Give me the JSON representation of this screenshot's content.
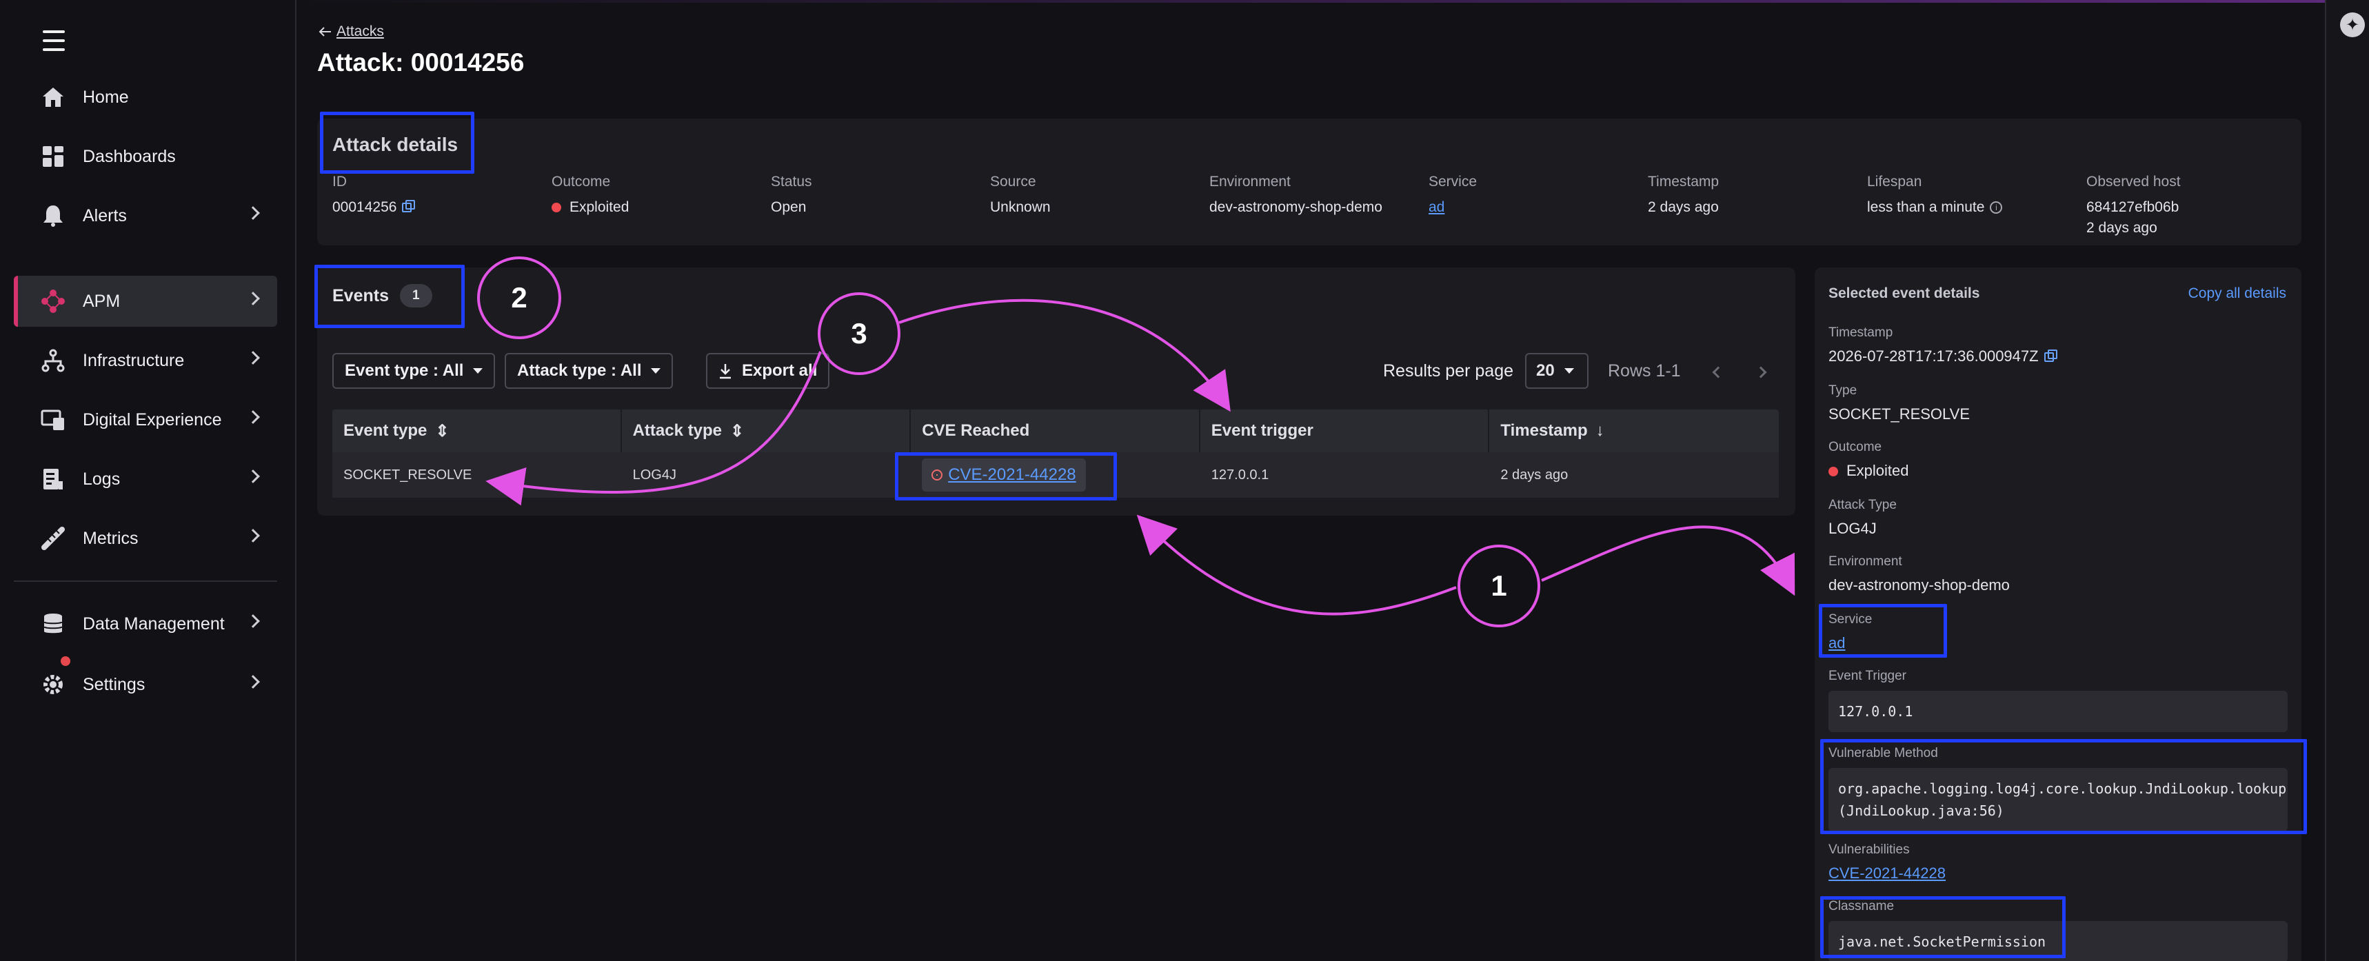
{
  "sidebar": {
    "items": [
      {
        "label": "Home",
        "icon": "home-icon"
      },
      {
        "label": "Dashboards",
        "icon": "dashboards-icon"
      },
      {
        "label": "Alerts",
        "icon": "bell-icon"
      },
      {
        "label": "APM",
        "icon": "apm-icon",
        "active": true
      },
      {
        "label": "Infrastructure",
        "icon": "infrastructure-icon"
      },
      {
        "label": "Digital Experience",
        "icon": "digital-experience-icon"
      },
      {
        "label": "Logs",
        "icon": "logs-icon"
      },
      {
        "label": "Metrics",
        "icon": "metrics-icon"
      },
      {
        "label": "Data Management",
        "icon": "database-icon"
      },
      {
        "label": "Settings",
        "icon": "gear-icon"
      }
    ]
  },
  "header": {
    "back_label": "Attacks",
    "title": "Attack: 00014256"
  },
  "details": {
    "title": "Attack details",
    "fields": [
      {
        "label": "ID",
        "value": "00014256"
      },
      {
        "label": "Outcome",
        "value": "Exploited"
      },
      {
        "label": "Status",
        "value": "Open"
      },
      {
        "label": "Source",
        "value": "Unknown"
      },
      {
        "label": "Environment",
        "value": "dev-astronomy-shop-demo"
      },
      {
        "label": "Service",
        "value": "ad"
      },
      {
        "label": "Timestamp",
        "value": "2 days ago"
      },
      {
        "label": "Lifespan",
        "value": "less than a minute"
      },
      {
        "label": "Observed host",
        "value": "684127efb06b",
        "value2": "2 days ago"
      }
    ]
  },
  "events": {
    "tab_label": "Events",
    "count": "1",
    "filters": {
      "event_type": "Event type : All",
      "attack_type": "Attack type : All",
      "export": "Export all"
    },
    "results_per_page_label": "Results per page",
    "results_per_page": "20",
    "rows_label": "Rows 1-1",
    "columns": [
      "Event type",
      "Attack type",
      "CVE Reached",
      "Event trigger",
      "Timestamp"
    ],
    "rows": [
      {
        "event_type": "SOCKET_RESOLVE",
        "attack_type": "LOG4J",
        "cve": "CVE-2021-44228",
        "trigger": "127.0.0.1",
        "timestamp": "2 days ago"
      }
    ]
  },
  "selected_event": {
    "title": "Selected event details",
    "copy_all": "Copy all details",
    "timestamp_label": "Timestamp",
    "timestamp": "2026-07-28T17:17:36.000947Z",
    "type_label": "Type",
    "type": "SOCKET_RESOLVE",
    "outcome_label": "Outcome",
    "outcome": "Exploited",
    "attack_type_label": "Attack Type",
    "attack_type": "LOG4J",
    "environment_label": "Environment",
    "environment": "dev-astronomy-shop-demo",
    "service_label": "Service",
    "service": "ad",
    "event_trigger_label": "Event Trigger",
    "event_trigger": "127.0.0.1",
    "vuln_method_label": "Vulnerable Method",
    "vuln_method_line1": "org.apache.logging.log4j.core.lookup.JndiLookup.lookup",
    "vuln_method_line2": "(JndiLookup.java:56)",
    "vulnerabilities_label": "Vulnerabilities",
    "vulnerabilities": "CVE-2021-44228",
    "classname_label": "Classname",
    "classname": "java.net.SocketPermission"
  },
  "annotations": {
    "labels": [
      "1",
      "2",
      "3"
    ],
    "box_color": "#1f3cff",
    "arrow_color": "#e254e6"
  },
  "colors": {
    "accent_link": "#5b9bff",
    "active_marker": "#d6336c",
    "exploited_dot": "#f0494f"
  }
}
